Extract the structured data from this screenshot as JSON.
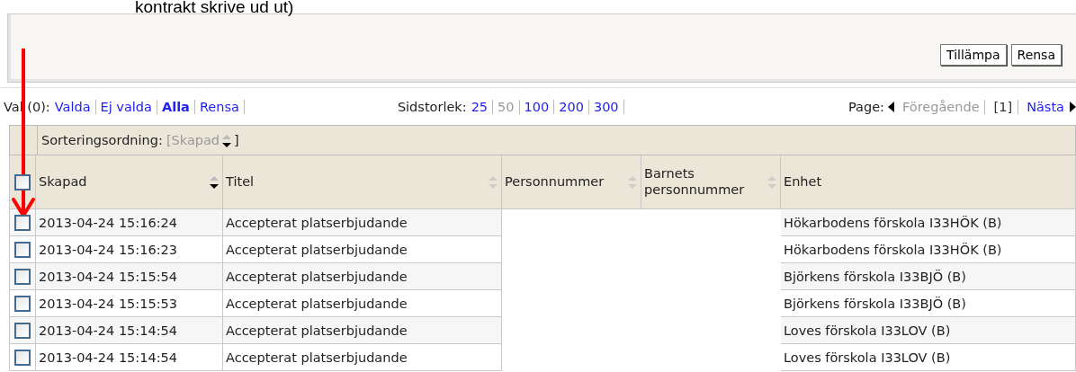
{
  "heading": "kontrakt skrive ud ut)",
  "filter_buttons": [
    "Tillämpa",
    "Rensa"
  ],
  "selection": {
    "label": "Val (0):",
    "options": [
      {
        "label": "Valda",
        "selected": false
      },
      {
        "label": "Ej valda",
        "selected": false
      },
      {
        "label": "Alla",
        "selected": true
      },
      {
        "label": "Rensa",
        "selected": false
      }
    ]
  },
  "page_size": {
    "label": "Sidstorlek:",
    "options": [
      {
        "label": "25",
        "selected": false
      },
      {
        "label": "50",
        "selected": true
      },
      {
        "label": "100",
        "selected": false
      },
      {
        "label": "200",
        "selected": false
      },
      {
        "label": "300",
        "selected": false
      }
    ]
  },
  "pager": {
    "label": "Page:",
    "previous": {
      "label": "Föregående",
      "disabled": true
    },
    "current": "[1]",
    "next": {
      "label": "Nästa",
      "disabled": false
    }
  },
  "sort_order": {
    "label": "Sorteringsordning:",
    "open": "[",
    "value": "Skapad",
    "close": "]"
  },
  "table": {
    "select_all_checked": false,
    "columns": [
      {
        "label": "Skapad",
        "sortable": true,
        "sorted": true
      },
      {
        "label": "Titel",
        "sortable": true,
        "sorted": false
      },
      {
        "label": "Personnummer",
        "sortable": true,
        "sorted": false
      },
      {
        "label": "Barnets personnummer",
        "sortable": true,
        "sorted": false
      },
      {
        "label": "Enhet",
        "sortable": false
      }
    ],
    "rows": [
      {
        "checked": false,
        "cells": [
          "2013-04-24 15:16:24",
          "Accepterat platserbjudande",
          "",
          "",
          "Hökarbodens förskola I33HÖK (B)"
        ]
      },
      {
        "checked": false,
        "cells": [
          "2013-04-24 15:16:23",
          "Accepterat platserbjudande",
          "",
          "",
          "Hökarbodens förskola I33HÖK (B)"
        ]
      },
      {
        "checked": false,
        "cells": [
          "2013-04-24 15:15:54",
          "Accepterat platserbjudande",
          "",
          "",
          "Björkens förskola I33BJÖ (B)"
        ]
      },
      {
        "checked": false,
        "cells": [
          "2013-04-24 15:15:53",
          "Accepterat platserbjudande",
          "",
          "",
          "Björkens förskola I33BJÖ (B)"
        ]
      },
      {
        "checked": false,
        "cells": [
          "2013-04-24 15:14:54",
          "Accepterat platserbjudande",
          "",
          "",
          "Loves förskola I33LOV (B)"
        ]
      },
      {
        "checked": false,
        "cells": [
          "2013-04-24 15:14:54",
          "Accepterat platserbjudande",
          "",
          "",
          "Loves förskola I33LOV (B)"
        ]
      }
    ]
  }
}
